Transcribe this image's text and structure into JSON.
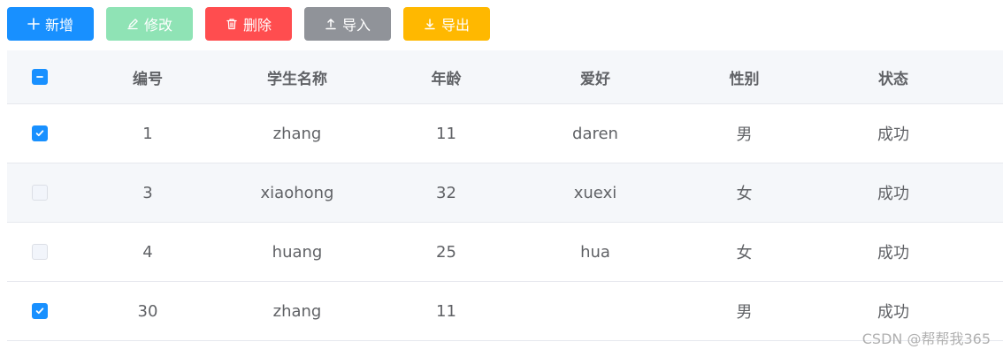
{
  "toolbar": {
    "add_label": "新增",
    "edit_label": "修改",
    "delete_label": "删除",
    "import_label": "导入",
    "export_label": "导出"
  },
  "table": {
    "headers": [
      "编号",
      "学生名称",
      "年龄",
      "爱好",
      "性别",
      "状态"
    ],
    "rows": [
      {
        "checked": true,
        "id": "1",
        "name": "zhang",
        "age": "11",
        "hobby": "daren",
        "gender": "男",
        "status": "成功"
      },
      {
        "checked": false,
        "id": "3",
        "name": "xiaohong",
        "age": "32",
        "hobby": "xuexi",
        "gender": "女",
        "status": "成功"
      },
      {
        "checked": false,
        "id": "4",
        "name": "huang",
        "age": "25",
        "hobby": "hua",
        "gender": "女",
        "status": "成功"
      },
      {
        "checked": true,
        "id": "30",
        "name": "zhang",
        "age": "11",
        "hobby": "",
        "gender": "男",
        "status": "成功"
      }
    ]
  },
  "watermark": "CSDN @帮帮我365",
  "colors": {
    "primary": "#1890ff",
    "success_light": "#8fe3b5",
    "danger": "#ff4d4f",
    "info": "#909399",
    "warning": "#ffb800"
  },
  "icons": {
    "add": "plus-icon",
    "edit": "edit-icon",
    "delete": "trash-icon",
    "import": "upload-icon",
    "export": "download-icon",
    "check": "check-icon",
    "indeterminate": "minus-icon"
  }
}
